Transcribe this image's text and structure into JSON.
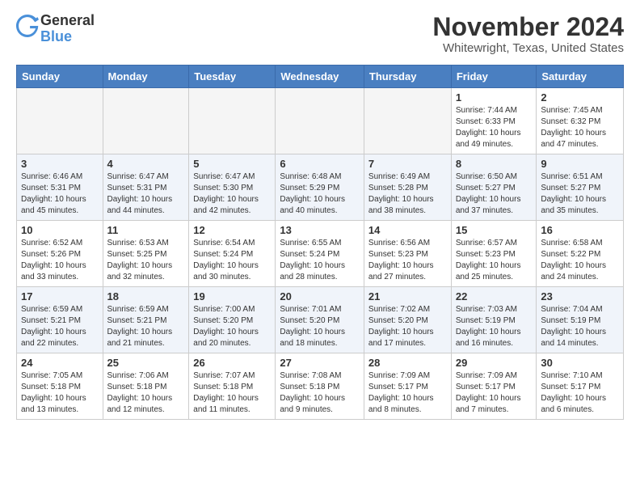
{
  "header": {
    "logo_general": "General",
    "logo_blue": "Blue",
    "month": "November 2024",
    "location": "Whitewright, Texas, United States"
  },
  "weekdays": [
    "Sunday",
    "Monday",
    "Tuesday",
    "Wednesday",
    "Thursday",
    "Friday",
    "Saturday"
  ],
  "weeks": [
    {
      "rowClass": "row-odd",
      "days": [
        {
          "empty": true
        },
        {
          "empty": true
        },
        {
          "empty": true
        },
        {
          "empty": true
        },
        {
          "empty": true
        },
        {
          "num": "1",
          "info": "Sunrise: 7:44 AM\nSunset: 6:33 PM\nDaylight: 10 hours\nand 49 minutes."
        },
        {
          "num": "2",
          "info": "Sunrise: 7:45 AM\nSunset: 6:32 PM\nDaylight: 10 hours\nand 47 minutes."
        }
      ]
    },
    {
      "rowClass": "row-even",
      "days": [
        {
          "num": "3",
          "info": "Sunrise: 6:46 AM\nSunset: 5:31 PM\nDaylight: 10 hours\nand 45 minutes."
        },
        {
          "num": "4",
          "info": "Sunrise: 6:47 AM\nSunset: 5:31 PM\nDaylight: 10 hours\nand 44 minutes."
        },
        {
          "num": "5",
          "info": "Sunrise: 6:47 AM\nSunset: 5:30 PM\nDaylight: 10 hours\nand 42 minutes."
        },
        {
          "num": "6",
          "info": "Sunrise: 6:48 AM\nSunset: 5:29 PM\nDaylight: 10 hours\nand 40 minutes."
        },
        {
          "num": "7",
          "info": "Sunrise: 6:49 AM\nSunset: 5:28 PM\nDaylight: 10 hours\nand 38 minutes."
        },
        {
          "num": "8",
          "info": "Sunrise: 6:50 AM\nSunset: 5:27 PM\nDaylight: 10 hours\nand 37 minutes."
        },
        {
          "num": "9",
          "info": "Sunrise: 6:51 AM\nSunset: 5:27 PM\nDaylight: 10 hours\nand 35 minutes."
        }
      ]
    },
    {
      "rowClass": "row-odd",
      "days": [
        {
          "num": "10",
          "info": "Sunrise: 6:52 AM\nSunset: 5:26 PM\nDaylight: 10 hours\nand 33 minutes."
        },
        {
          "num": "11",
          "info": "Sunrise: 6:53 AM\nSunset: 5:25 PM\nDaylight: 10 hours\nand 32 minutes."
        },
        {
          "num": "12",
          "info": "Sunrise: 6:54 AM\nSunset: 5:24 PM\nDaylight: 10 hours\nand 30 minutes."
        },
        {
          "num": "13",
          "info": "Sunrise: 6:55 AM\nSunset: 5:24 PM\nDaylight: 10 hours\nand 28 minutes."
        },
        {
          "num": "14",
          "info": "Sunrise: 6:56 AM\nSunset: 5:23 PM\nDaylight: 10 hours\nand 27 minutes."
        },
        {
          "num": "15",
          "info": "Sunrise: 6:57 AM\nSunset: 5:23 PM\nDaylight: 10 hours\nand 25 minutes."
        },
        {
          "num": "16",
          "info": "Sunrise: 6:58 AM\nSunset: 5:22 PM\nDaylight: 10 hours\nand 24 minutes."
        }
      ]
    },
    {
      "rowClass": "row-even",
      "days": [
        {
          "num": "17",
          "info": "Sunrise: 6:59 AM\nSunset: 5:21 PM\nDaylight: 10 hours\nand 22 minutes."
        },
        {
          "num": "18",
          "info": "Sunrise: 6:59 AM\nSunset: 5:21 PM\nDaylight: 10 hours\nand 21 minutes."
        },
        {
          "num": "19",
          "info": "Sunrise: 7:00 AM\nSunset: 5:20 PM\nDaylight: 10 hours\nand 20 minutes."
        },
        {
          "num": "20",
          "info": "Sunrise: 7:01 AM\nSunset: 5:20 PM\nDaylight: 10 hours\nand 18 minutes."
        },
        {
          "num": "21",
          "info": "Sunrise: 7:02 AM\nSunset: 5:20 PM\nDaylight: 10 hours\nand 17 minutes."
        },
        {
          "num": "22",
          "info": "Sunrise: 7:03 AM\nSunset: 5:19 PM\nDaylight: 10 hours\nand 16 minutes."
        },
        {
          "num": "23",
          "info": "Sunrise: 7:04 AM\nSunset: 5:19 PM\nDaylight: 10 hours\nand 14 minutes."
        }
      ]
    },
    {
      "rowClass": "row-odd",
      "days": [
        {
          "num": "24",
          "info": "Sunrise: 7:05 AM\nSunset: 5:18 PM\nDaylight: 10 hours\nand 13 minutes."
        },
        {
          "num": "25",
          "info": "Sunrise: 7:06 AM\nSunset: 5:18 PM\nDaylight: 10 hours\nand 12 minutes."
        },
        {
          "num": "26",
          "info": "Sunrise: 7:07 AM\nSunset: 5:18 PM\nDaylight: 10 hours\nand 11 minutes."
        },
        {
          "num": "27",
          "info": "Sunrise: 7:08 AM\nSunset: 5:18 PM\nDaylight: 10 hours\nand 9 minutes."
        },
        {
          "num": "28",
          "info": "Sunrise: 7:09 AM\nSunset: 5:17 PM\nDaylight: 10 hours\nand 8 minutes."
        },
        {
          "num": "29",
          "info": "Sunrise: 7:09 AM\nSunset: 5:17 PM\nDaylight: 10 hours\nand 7 minutes."
        },
        {
          "num": "30",
          "info": "Sunrise: 7:10 AM\nSunset: 5:17 PM\nDaylight: 10 hours\nand 6 minutes."
        }
      ]
    }
  ]
}
